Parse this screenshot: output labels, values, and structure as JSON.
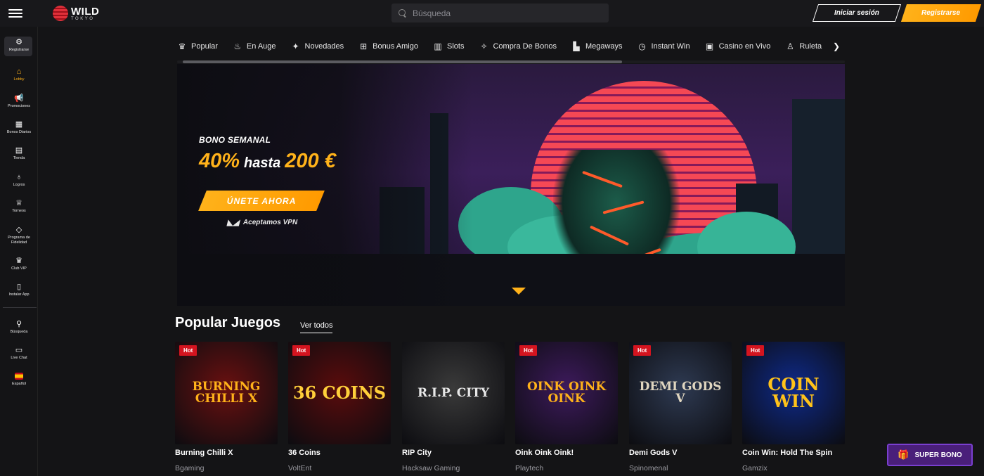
{
  "header": {
    "logo_wild": "WILD",
    "logo_tokyo": "TOKYO",
    "search_placeholder": "Búsqueda",
    "login_label": "Iniciar sesión",
    "register_label": "Registrarse"
  },
  "sidebar": {
    "items": [
      {
        "label": "Registrarse",
        "icon": "register-icon"
      },
      {
        "label": "Lobby",
        "icon": "home-icon"
      },
      {
        "label": "Promociones",
        "icon": "megaphone-icon"
      },
      {
        "label": "Bonos Diarios",
        "icon": "calendar-icon"
      },
      {
        "label": "Tienda",
        "icon": "shop-icon"
      },
      {
        "label": "Logros",
        "icon": "medal-icon"
      },
      {
        "label": "Torneos",
        "icon": "trophy-icon"
      },
      {
        "label": "Programa de Fidelidad",
        "icon": "diamond-icon"
      },
      {
        "label": "Club VIP",
        "icon": "crown-icon"
      },
      {
        "label": "Instalar App",
        "icon": "phone-icon"
      },
      {
        "label": "Búsqueda",
        "icon": "search-icon"
      },
      {
        "label": "Live Chat",
        "icon": "chat-icon"
      },
      {
        "label": "Español",
        "icon": "spain-flag-icon"
      }
    ],
    "active_color": "#ffb21a"
  },
  "categories": [
    {
      "label": "Popular",
      "icon": "crown-icon"
    },
    {
      "label": "En Auge",
      "icon": "fire-icon"
    },
    {
      "label": "Novedades",
      "icon": "sparkle-icon"
    },
    {
      "label": "Bonus Amigo",
      "icon": "gift-icon"
    },
    {
      "label": "Slots",
      "icon": "slot-icon"
    },
    {
      "label": "Compra De Bonos",
      "icon": "bonus-buy-icon"
    },
    {
      "label": "Megaways",
      "icon": "megaways-icon"
    },
    {
      "label": "Instant Win",
      "icon": "stopwatch-icon"
    },
    {
      "label": "Casino en Vivo",
      "icon": "live-casino-icon"
    },
    {
      "label": "Ruleta",
      "icon": "roulette-icon"
    }
  ],
  "banner": {
    "label": "BONO SEMANAL",
    "percent": "40%",
    "middle": "hasta",
    "amount": "200 €",
    "cta": "ÚNETE AHORA",
    "vpn": "Aceptamos VPN"
  },
  "popular": {
    "title": "Popular Juegos",
    "see_all": "Ver todos",
    "hot_label": "Hot",
    "games": [
      {
        "name": "Burning Chilli X",
        "provider": "Bgaming",
        "hot": true,
        "art": "BURNING CHILLI X",
        "bg": "#6a1010",
        "fg": "#ffb21a"
      },
      {
        "name": "36 Coins",
        "provider": "VoltEnt",
        "hot": true,
        "art": "36 COINS",
        "bg": "#5a0c0c",
        "fg": "#ffcf3a"
      },
      {
        "name": "RIP City",
        "provider": "Hacksaw Gaming",
        "hot": false,
        "art": "R.I.P. CITY",
        "bg": "#3a3a3a",
        "fg": "#e8e8e8"
      },
      {
        "name": "Oink Oink Oink!",
        "provider": "Playtech",
        "hot": true,
        "art": "OINK OINK OINK",
        "bg": "#3d1a5c",
        "fg": "#ffb21a"
      },
      {
        "name": "Demi Gods V",
        "provider": "Spinomenal",
        "hot": true,
        "art": "DEMI GODS V",
        "bg": "#2e3a52",
        "fg": "#e0d6c0"
      },
      {
        "name": "Coin Win: Hold The Spin",
        "provider": "Gamzix",
        "hot": true,
        "art": "COIN WIN",
        "bg": "#0e2a8a",
        "fg": "#ffc21a"
      }
    ]
  },
  "super_bono": "SUPER BONO"
}
